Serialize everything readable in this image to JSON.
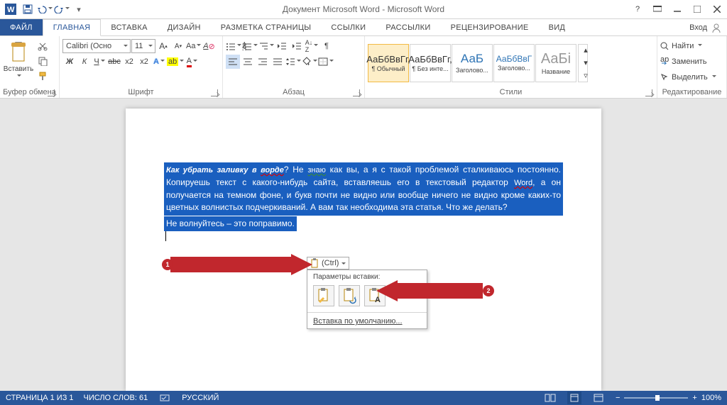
{
  "title": "Документ Microsoft Word - Microsoft Word",
  "login": "Вход",
  "tabs": {
    "file": "ФАЙЛ",
    "items": [
      "ГЛАВНАЯ",
      "ВСТАВКА",
      "ДИЗАЙН",
      "РАЗМЕТКА СТРАНИЦЫ",
      "ССЫЛКИ",
      "РАССЫЛКИ",
      "РЕЦЕНЗИРОВАНИЕ",
      "ВИД"
    ],
    "active": 0
  },
  "ribbon": {
    "clipboard": {
      "label": "Буфер обмена",
      "paste": "Вставить"
    },
    "font": {
      "label": "Шрифт",
      "name": "Calibri (Осно",
      "size": "11"
    },
    "paragraph": {
      "label": "Абзац"
    },
    "styles": {
      "label": "Стили",
      "items": [
        {
          "preview": "АаБбВвГг,",
          "name": "¶ Обычный",
          "sel": true,
          "color": "#333"
        },
        {
          "preview": "АаБбВвГг,",
          "name": "¶ Без инте...",
          "color": "#333"
        },
        {
          "preview": "АаБ",
          "name": "Заголово...",
          "color": "#2e74b5",
          "size": "17px",
          "weight": "300"
        },
        {
          "preview": "АаБбВвГ",
          "name": "Заголово...",
          "color": "#2e74b5",
          "size": "12px"
        },
        {
          "preview": "АаБі",
          "name": "Название",
          "color": "#aaa",
          "size": "20px",
          "weight": "300"
        }
      ]
    },
    "editing": {
      "label": "Редактирование",
      "find": "Найти",
      "replace": "Заменить",
      "select": "Выделить"
    }
  },
  "document": {
    "paragraph_html": "<span class='bi'>Как убрать заливку в <span class='wave'>ворде</span></span>? Не <span class='wave2'>знаю</span> как вы, а я с такой проблемой сталкиваюсь постоянно. Копируешь текст с какого-нибудь сайта, вставляешь его в текстовый редактор <span class='wave'>Word</span>, а он получается на темном фоне, и букв почти не видно или вообще ничего не видно кроме каких-то цветных волнистых подчеркиваний. А вам так необходима эта статья. Что же делать?",
    "line2": "Не волнуйтесь – это поправимо."
  },
  "paste": {
    "tag": "(Ctrl)",
    "title": "Параметры вставки:",
    "default": "Вставка по умолчанию..."
  },
  "annotations": {
    "b1": "1",
    "b2": "2"
  },
  "status": {
    "page": "СТРАНИЦА 1 ИЗ 1",
    "words": "ЧИСЛО СЛОВ: 61",
    "lang": "РУССКИЙ",
    "zoom": "100%"
  }
}
